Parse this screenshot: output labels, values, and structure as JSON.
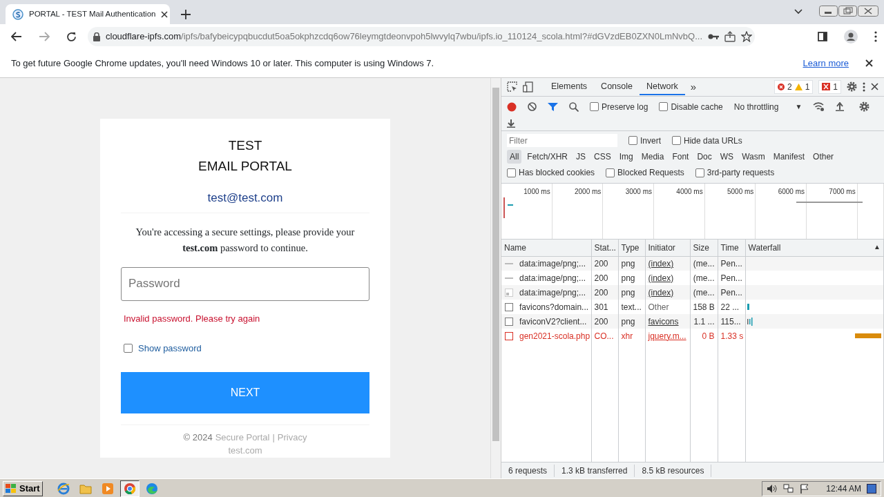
{
  "browser_tab": {
    "title": "PORTAL - TEST Mail Authentication"
  },
  "address_bar": {
    "host": "cloudflare-ipfs.com",
    "path": "/ipfs/bafybeicypqbucdut5oa5okphzcdq6ow76leymgtdeonvpoh5lwvylq7wbu/ipfs.io_110124_scola.html?#dGVzdEB0ZXN0LmNvbQ..."
  },
  "infobar": {
    "message": "To get future Google Chrome updates, you'll need Windows 10 or later. This computer is using Windows 7.",
    "link": "Learn more"
  },
  "login": {
    "title_lines": [
      "TEST",
      "EMAIL PORTAL"
    ],
    "email": "test@test.com",
    "message": "You're accessing a secure settings, please provide your **test.com** password to continue.",
    "password": {
      "placeholder": "Password"
    },
    "error": "Invalid password. Please try again",
    "show_password": {
      "label": "Show password",
      "checked": false
    },
    "button": "NEXT",
    "footer": {
      "copyright": "© 2024",
      "brand": "Secure Portal",
      "separator": "|",
      "privacy": "Privacy",
      "domain": "test.com"
    }
  },
  "devtools": {
    "tabs": [
      {
        "label": "Elements",
        "selected": false
      },
      {
        "label": "Console",
        "selected": false
      },
      {
        "label": "Network",
        "selected": true
      }
    ],
    "more": "»",
    "errors": "2",
    "warnings": "1",
    "issues": "1",
    "recording": true,
    "preserve_log": {
      "label": "Preserve log",
      "checked": false
    },
    "disable_cache": {
      "label": "Disable cache",
      "checked": false
    },
    "throttling": "No throttling",
    "dropdown": "▼",
    "filter": {
      "placeholder": "Filter"
    },
    "invert": {
      "label": "Invert",
      "checked": false
    },
    "hide_data_urls": {
      "label": "Hide data URLs",
      "checked": false
    },
    "types": [
      {
        "label": "All",
        "selected": true
      },
      {
        "label": "Fetch/XHR",
        "selected": false
      },
      {
        "label": "JS",
        "selected": false
      },
      {
        "label": "CSS",
        "selected": false
      },
      {
        "label": "Img",
        "selected": false
      },
      {
        "label": "Media",
        "selected": false
      },
      {
        "label": "Font",
        "selected": false
      },
      {
        "label": "Doc",
        "selected": false
      },
      {
        "label": "WS",
        "selected": false
      },
      {
        "label": "Wasm",
        "selected": false
      },
      {
        "label": "Manifest",
        "selected": false
      },
      {
        "label": "Other",
        "selected": false
      }
    ],
    "blocked_cookies": {
      "label": "Has blocked cookies",
      "checked": false
    },
    "blocked_requests": {
      "label": "Blocked Requests",
      "checked": false
    },
    "third_party": {
      "label": "3rd-party requests",
      "checked": false
    },
    "overview_ticks": [
      "1000 ms",
      "2000 ms",
      "3000 ms",
      "4000 ms",
      "5000 ms",
      "6000 ms",
      "7000 ms"
    ],
    "columns": [
      "Name",
      "Stat...",
      "Type",
      "Initiator",
      "Size",
      "Time",
      "Waterfall"
    ],
    "sort_arrow": "▲",
    "rows": [
      {
        "kind": "line",
        "name": "data:image/png;...",
        "status": "200",
        "type": "png",
        "initiator": "(index)",
        "initiator_link": true,
        "size": "(me...",
        "time": "Pen...",
        "error": false
      },
      {
        "kind": "line",
        "name": "data:image/png;...",
        "status": "200",
        "type": "png",
        "initiator": "(index)",
        "initiator_link": true,
        "size": "(me...",
        "time": "Pen...",
        "error": false
      },
      {
        "kind": "image",
        "name": "data:image/png;...",
        "status": "200",
        "type": "png",
        "initiator": "(index)",
        "initiator_link": true,
        "size": "(me...",
        "time": "Pen...",
        "error": false
      },
      {
        "kind": "file",
        "name": "favicons?domain...",
        "status": "301",
        "type": "text...",
        "initiator": "Other",
        "initiator_link": false,
        "size": "158 B",
        "time": "22 ...",
        "error": false
      },
      {
        "kind": "file",
        "name": "faviconV2?client...",
        "status": "200",
        "type": "png",
        "initiator": "favicons",
        "initiator_link": true,
        "size": "1.1 ...",
        "time": "115...",
        "error": false
      },
      {
        "kind": "file",
        "name": "gen2021-scola.php",
        "status": "CO...",
        "type": "xhr",
        "initiator": "jquery.m...",
        "initiator_link": true,
        "size": "0 B",
        "time": "1.33 s",
        "error": true
      }
    ],
    "summary": [
      "6 requests",
      "1.3 kB transferred",
      "8.5 kB resources"
    ]
  },
  "taskbar": {
    "start": "Start",
    "clock": "12:44 AM"
  }
}
